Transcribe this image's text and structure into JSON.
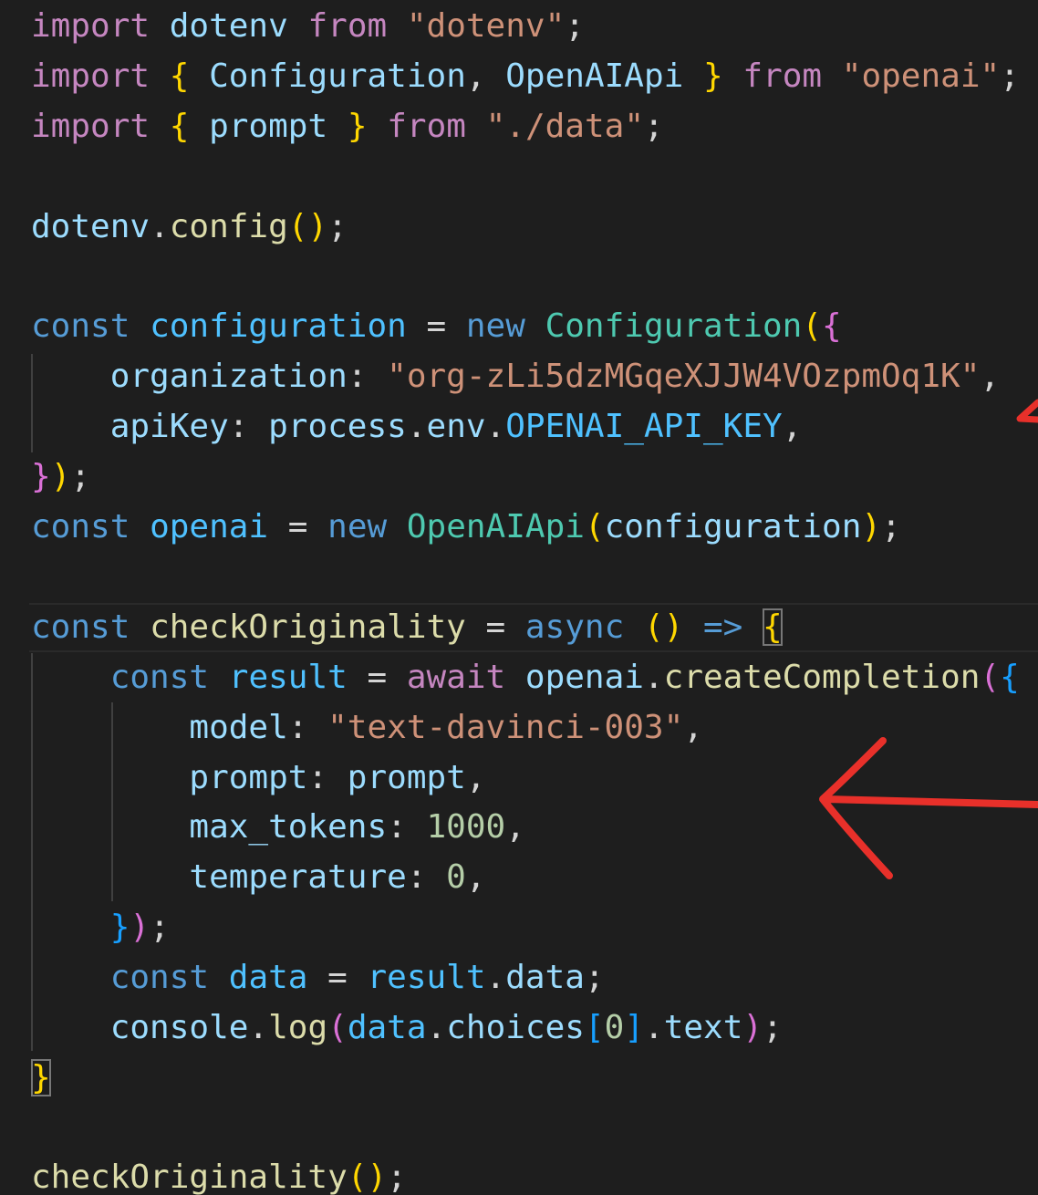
{
  "code": {
    "l01": [
      "import",
      " ",
      "dotenv",
      " ",
      "from",
      " ",
      "\"dotenv\"",
      ";"
    ],
    "l02": [
      "import",
      " ",
      "{",
      " ",
      "Configuration",
      ",",
      " ",
      "OpenAIApi",
      " ",
      "}",
      " ",
      "from",
      " ",
      "\"openai\"",
      ";"
    ],
    "l03": [
      "import",
      " ",
      "{",
      " ",
      "prompt",
      " ",
      "}",
      " ",
      "from",
      " ",
      "\"./data\"",
      ";"
    ],
    "l05": [
      "dotenv",
      ".",
      "config",
      "(",
      ")",
      ";"
    ],
    "l07": [
      "const",
      " ",
      "configuration",
      " = ",
      "new",
      " ",
      "Configuration",
      "(",
      "{"
    ],
    "l08": [
      "    ",
      "organization",
      ": ",
      "\"org-zLi5dzMGqeXJJW4VOzpmOq1K\"",
      ","
    ],
    "l09": [
      "    ",
      "apiKey",
      ": ",
      "process",
      ".",
      "env",
      ".",
      "OPENAI_API_KEY",
      ","
    ],
    "l10": [
      "}",
      ")",
      ";"
    ],
    "l11": [
      "const",
      " ",
      "openai",
      " = ",
      "new",
      " ",
      "OpenAIApi",
      "(",
      "configuration",
      ")",
      ";"
    ],
    "l13": [
      "const",
      " ",
      "checkOriginality",
      " = ",
      "async",
      " ",
      "()",
      " ",
      "=>",
      " ",
      "{"
    ],
    "l14": [
      "    ",
      "const",
      " ",
      "result",
      " = ",
      "await",
      " ",
      "openai",
      ".",
      "createCompletion",
      "(",
      "{"
    ],
    "l15": [
      "        ",
      "model",
      ": ",
      "\"text-davinci-003\"",
      ","
    ],
    "l16": [
      "        ",
      "prompt",
      ": ",
      "prompt",
      ","
    ],
    "l17": [
      "        ",
      "max_tokens",
      ": ",
      "1000",
      ","
    ],
    "l18": [
      "        ",
      "temperature",
      ": ",
      "0",
      ","
    ],
    "l19": [
      "    ",
      "}",
      ")",
      ";"
    ],
    "l20": [
      "    ",
      "const",
      " ",
      "data",
      " = ",
      "result",
      ".",
      "data",
      ";"
    ],
    "l21": [
      "    ",
      "console",
      ".",
      "log",
      "(",
      "data",
      ".",
      "choices",
      "[",
      "0",
      "]",
      ".",
      "text",
      ")",
      ";"
    ],
    "l22": [
      "}"
    ],
    "l24": [
      "checkOriginality",
      "(",
      ")",
      ";"
    ]
  },
  "theme": {
    "background": "#1e1e1e",
    "annotation_arrow_color": "#e8302a"
  }
}
